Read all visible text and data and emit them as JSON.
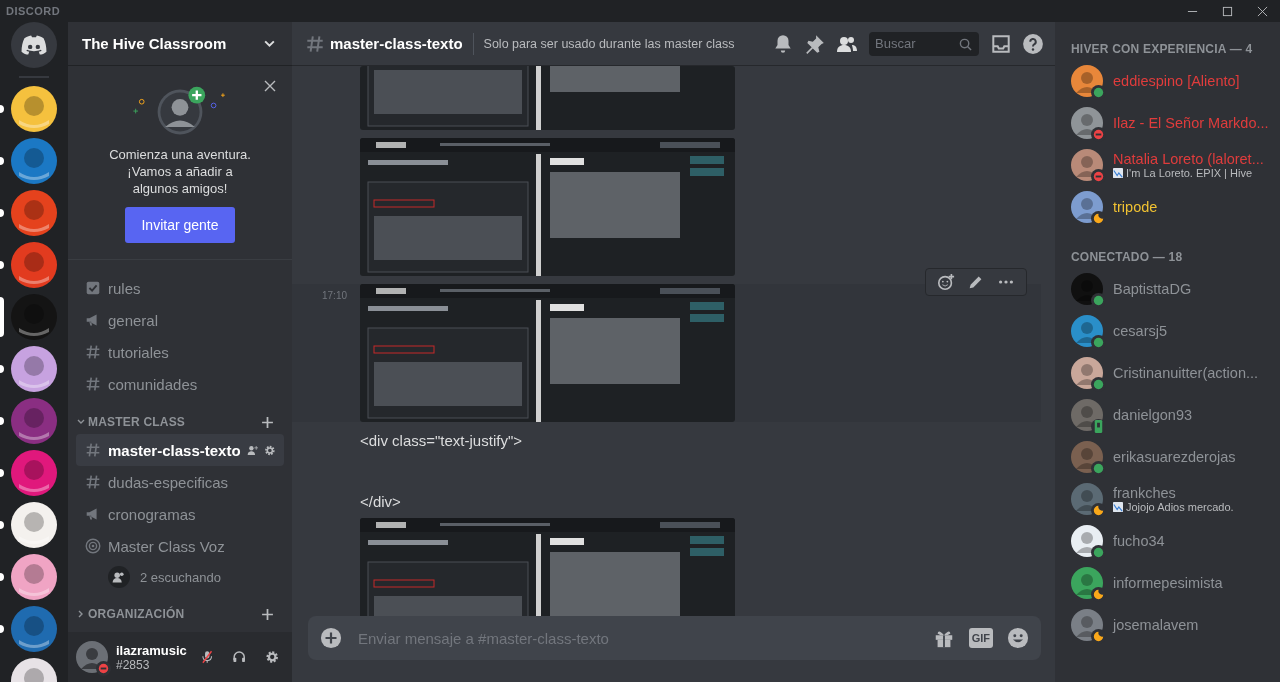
{
  "titlebar": {
    "wordmark": "DISCORD"
  },
  "servers": [
    {
      "color": "#f5c13e",
      "unread": true,
      "selected": false
    },
    {
      "color": "#1b78c4",
      "unread": true,
      "selected": false
    },
    {
      "color": "#e5421d",
      "unread": true,
      "selected": false
    },
    {
      "color": "#e23b1f",
      "unread": true,
      "selected": false
    },
    {
      "color": "#141414",
      "unread": false,
      "selected": true
    },
    {
      "color": "#c7a2e0",
      "unread": true,
      "selected": false
    },
    {
      "color": "#8a2e82",
      "unread": true,
      "selected": false
    },
    {
      "color": "#e0187c",
      "unread": true,
      "selected": false
    },
    {
      "color": "#f4f1ee",
      "unread": true,
      "selected": false
    },
    {
      "color": "#f0a4c4",
      "unread": true,
      "selected": false
    },
    {
      "color": "#1f6bb0",
      "unread": true,
      "selected": false
    },
    {
      "color": "#e7e2e6",
      "unread": false,
      "selected": false
    }
  ],
  "sidebar": {
    "server_name": "The Hive Classroom",
    "promo": {
      "text": "Comienza una aventura. ¡Vamos a añadir a algunos amigos!",
      "button": "Invitar gente"
    },
    "channels": [
      {
        "kind": "rules",
        "name": "rules",
        "selected": false
      },
      {
        "kind": "announce",
        "name": "general",
        "selected": false
      },
      {
        "kind": "text",
        "name": "tutoriales",
        "selected": false
      },
      {
        "kind": "text",
        "name": "comunidades",
        "selected": false
      }
    ],
    "categories": [
      {
        "name": "MASTER CLASS",
        "expanded": true,
        "channels": [
          {
            "kind": "text",
            "name": "master-class-texto",
            "selected": true
          },
          {
            "kind": "text",
            "name": "dudas-especificas",
            "selected": false
          },
          {
            "kind": "announce",
            "name": "cronogramas",
            "selected": false
          },
          {
            "kind": "stage",
            "name": "Master Class Voz",
            "selected": false,
            "listeners": "2 escuchando"
          }
        ]
      },
      {
        "name": "ORGANIZACIÓN",
        "expanded": false
      }
    ],
    "user": {
      "name": "ilazramusic",
      "tag": "#2853",
      "status": {
        "kind": "dnd",
        "color": "#ed4245"
      },
      "muted": true
    }
  },
  "header": {
    "channel": "master-class-texto",
    "topic": "Solo para ser usado durante las master class",
    "search": {
      "placeholder": "Buscar"
    }
  },
  "messages": [
    {
      "kind": "picture"
    },
    {
      "kind": "picture"
    },
    {
      "kind": "picture",
      "time": "17:10",
      "hovered": true
    },
    {
      "kind": "text",
      "lines": [
        "<div class=\"text-justify\">",
        "</div>"
      ]
    },
    {
      "kind": "picture"
    }
  ],
  "composer": {
    "placeholder": "Enviar mensaje a #master-class-texto",
    "gif": "GIF"
  },
  "members": [
    {
      "heading": "HIVER CON EXPERIENCIA — 4",
      "items": [
        {
          "name": "eddiespino [Aliento]",
          "color": "#e03c3c",
          "status": {
            "kind": "online",
            "color": "#3ba55d"
          }
        },
        {
          "name": "Ilaz - El Señor Markdo...",
          "color": "#e03c3c",
          "status": {
            "kind": "dnd",
            "color": "#ed4245"
          }
        },
        {
          "name": "Natalia Loreto (laloret...",
          "color": "#e03c3c",
          "status": {
            "kind": "dnd",
            "color": "#ed4245"
          },
          "activity": "I'm La Loreto. EPIX | Hive"
        },
        {
          "name": "tripode",
          "color": "#f1c232",
          "status": {
            "kind": "idle",
            "color": "#faa81a"
          }
        }
      ]
    },
    {
      "heading": "CONECTADO — 18",
      "items": [
        {
          "name": "BaptisttaDG",
          "color": "#8e9297",
          "status": {
            "kind": "online",
            "color": "#3ba55d"
          }
        },
        {
          "name": "cesarsj5",
          "color": "#8e9297",
          "status": {
            "kind": "online",
            "color": "#3ba55d"
          }
        },
        {
          "name": "Cristinanuitter(action...",
          "color": "#8e9297",
          "status": {
            "kind": "online",
            "color": "#3ba55d"
          }
        },
        {
          "name": "danielgon93",
          "color": "#8e9297",
          "status": {
            "kind": "mobile",
            "color": "#3ba55d"
          }
        },
        {
          "name": "erikasuarezderojas",
          "color": "#8e9297",
          "status": {
            "kind": "online",
            "color": "#3ba55d"
          }
        },
        {
          "name": "frankches",
          "color": "#8e9297",
          "status": {
            "kind": "idle",
            "color": "#faa81a"
          },
          "activity": "Jojojo Adios mercado."
        },
        {
          "name": "fucho34",
          "color": "#8e9297",
          "status": {
            "kind": "online",
            "color": "#3ba55d"
          }
        },
        {
          "name": "informepesimista",
          "color": "#8e9297",
          "status": {
            "kind": "idle",
            "color": "#faa81a"
          }
        },
        {
          "name": "josemalavem",
          "color": "#8e9297",
          "status": {
            "kind": "idle",
            "color": "#faa81a"
          }
        }
      ]
    }
  ]
}
